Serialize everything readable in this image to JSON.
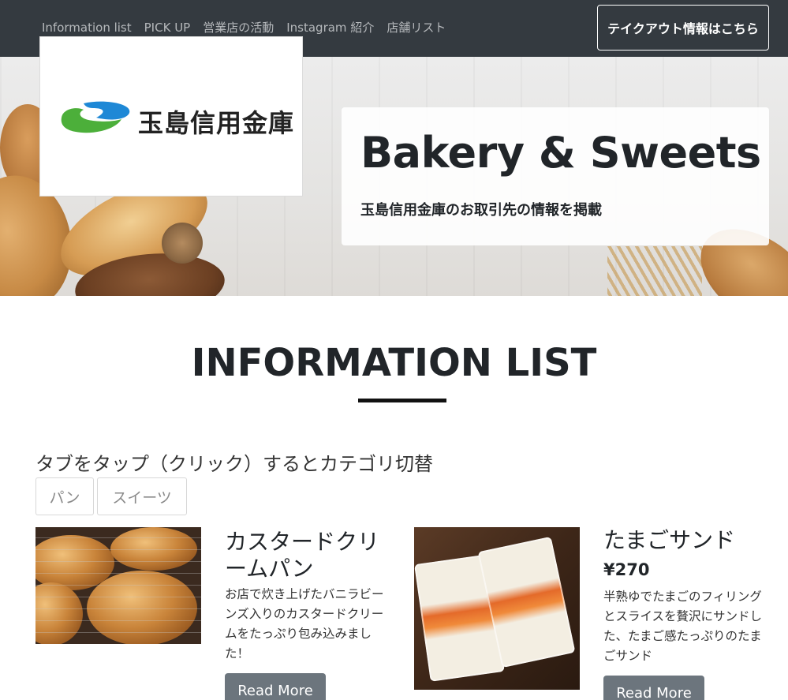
{
  "nav": {
    "links": [
      "Information list",
      "PICK UP",
      "営業店の活動",
      "Instagram 紹介",
      "店舗リスト"
    ],
    "takeout_label": "テイクアウト情報はこちら"
  },
  "brand": {
    "logo_text": "玉島信用金庫"
  },
  "hero": {
    "title": "Bakery & Sweets",
    "subtitle": "玉島信用金庫のお取引先の情報を掲載"
  },
  "section": {
    "title": "INFORMATION LIST",
    "tab_hint": "タブをタップ（クリック）するとカテゴリ切替",
    "tabs": [
      "パン",
      "スイーツ"
    ]
  },
  "cards": [
    {
      "title_line1": "カスタードクリ",
      "title_line2": "ームパン",
      "desc": [
        "お店で炊き上げたバニラビー",
        "ンズ入りのカスタードクリー",
        "ムをたっぷり包み込みまし",
        "た！"
      ],
      "button": "Read More"
    },
    {
      "title": "たまごサンド",
      "price": "¥270",
      "desc": [
        "半熟ゆでたまごのフィリング",
        "とスライスを贅沢にサンドし",
        "た、たまご感たっぷりのたま",
        "ごサンド"
      ],
      "button": "Read More"
    }
  ],
  "colors": {
    "nav_bg": "#343a40",
    "button_bg": "#6c757d",
    "logo_blue": "#1e88d6",
    "logo_green": "#4caf3a"
  }
}
